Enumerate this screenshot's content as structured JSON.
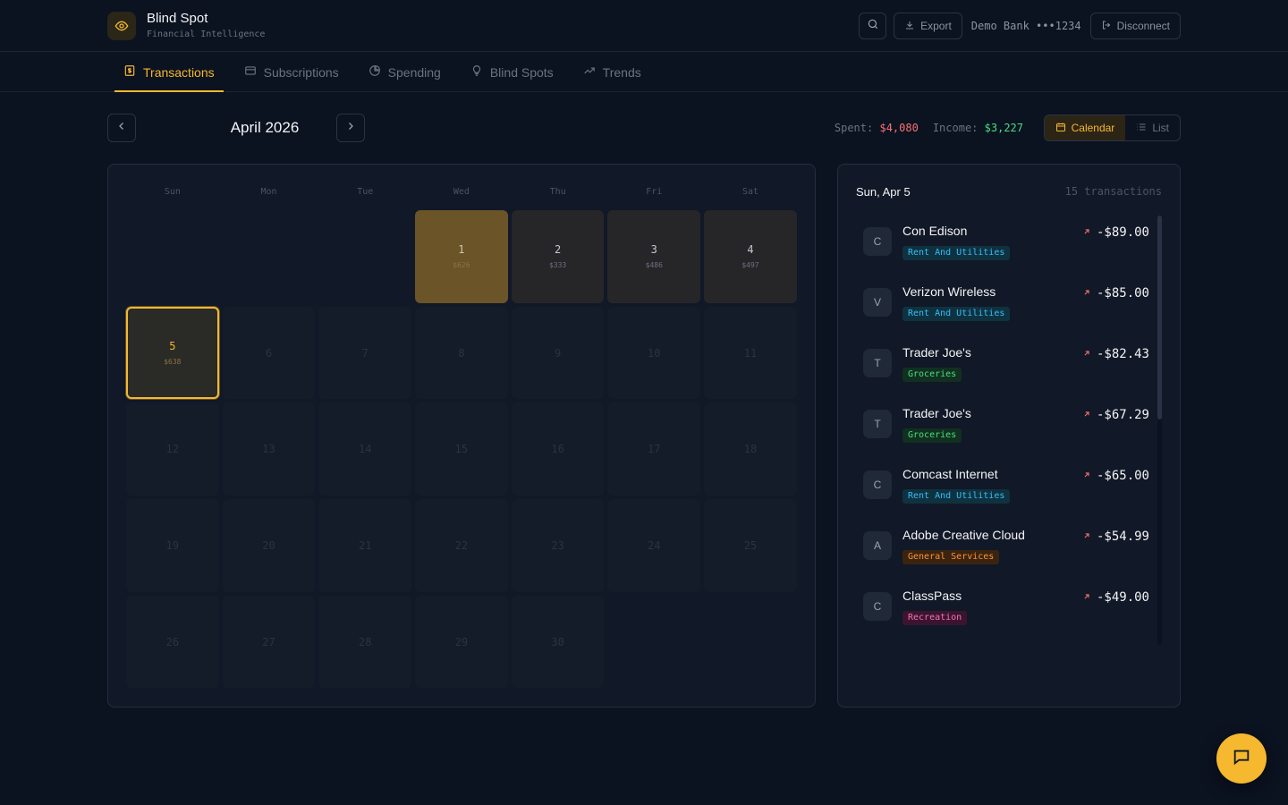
{
  "brand": {
    "title": "Blind Spot",
    "subtitle": "Financial Intelligence",
    "logo_icon": "eye-icon"
  },
  "header": {
    "search_icon": "search-icon",
    "export_label": "Export",
    "bank_label": "Demo Bank •••1234",
    "disconnect_label": "Disconnect"
  },
  "tabs": [
    {
      "label": "Transactions",
      "icon": "dollar-icon",
      "active": true
    },
    {
      "label": "Subscriptions",
      "icon": "card-icon",
      "active": false
    },
    {
      "label": "Spending",
      "icon": "pie-icon",
      "active": false
    },
    {
      "label": "Blind Spots",
      "icon": "bulb-icon",
      "active": false
    },
    {
      "label": "Trends",
      "icon": "trend-icon",
      "active": false
    }
  ],
  "toolbar": {
    "month": "April 2026",
    "spent_label": "Spent:",
    "spent_value": "$4,080",
    "income_label": "Income:",
    "income_value": "$3,227",
    "calendar_label": "Calendar",
    "list_label": "List"
  },
  "calendar": {
    "weekdays": [
      "Sun",
      "Mon",
      "Tue",
      "Wed",
      "Thu",
      "Fri",
      "Sat"
    ],
    "leading_empty": 3,
    "days": [
      {
        "day": "1",
        "amount": "$626",
        "state": "hot"
      },
      {
        "day": "2",
        "amount": "$333",
        "state": "active"
      },
      {
        "day": "3",
        "amount": "$486",
        "state": "active"
      },
      {
        "day": "4",
        "amount": "$497",
        "state": "active"
      },
      {
        "day": "5",
        "amount": "$638",
        "state": "selected"
      },
      {
        "day": "6",
        "amount": "",
        "state": "future"
      },
      {
        "day": "7",
        "amount": "",
        "state": "future"
      },
      {
        "day": "8",
        "amount": "",
        "state": "future"
      },
      {
        "day": "9",
        "amount": "",
        "state": "future"
      },
      {
        "day": "10",
        "amount": "",
        "state": "future"
      },
      {
        "day": "11",
        "amount": "",
        "state": "future"
      },
      {
        "day": "12",
        "amount": "",
        "state": "future"
      },
      {
        "day": "13",
        "amount": "",
        "state": "future"
      },
      {
        "day": "14",
        "amount": "",
        "state": "future"
      },
      {
        "day": "15",
        "amount": "",
        "state": "future"
      },
      {
        "day": "16",
        "amount": "",
        "state": "future"
      },
      {
        "day": "17",
        "amount": "",
        "state": "future"
      },
      {
        "day": "18",
        "amount": "",
        "state": "future"
      },
      {
        "day": "19",
        "amount": "",
        "state": "future"
      },
      {
        "day": "20",
        "amount": "",
        "state": "future"
      },
      {
        "day": "21",
        "amount": "",
        "state": "future"
      },
      {
        "day": "22",
        "amount": "",
        "state": "future"
      },
      {
        "day": "23",
        "amount": "",
        "state": "future"
      },
      {
        "day": "24",
        "amount": "",
        "state": "future"
      },
      {
        "day": "25",
        "amount": "",
        "state": "future"
      },
      {
        "day": "26",
        "amount": "",
        "state": "future"
      },
      {
        "day": "27",
        "amount": "",
        "state": "future"
      },
      {
        "day": "28",
        "amount": "",
        "state": "future"
      },
      {
        "day": "29",
        "amount": "",
        "state": "future"
      },
      {
        "day": "30",
        "amount": "",
        "state": "future"
      }
    ]
  },
  "detail": {
    "date": "Sun, Apr 5",
    "count": "15 transactions",
    "transactions": [
      {
        "initial": "C",
        "name": "Con Edison",
        "category": "Rent And Utilities",
        "cat_class": "cat-util",
        "amount": "-$89.00"
      },
      {
        "initial": "V",
        "name": "Verizon Wireless",
        "category": "Rent And Utilities",
        "cat_class": "cat-util",
        "amount": "-$85.00"
      },
      {
        "initial": "T",
        "name": "Trader Joe's",
        "category": "Groceries",
        "cat_class": "cat-groc",
        "amount": "-$82.43"
      },
      {
        "initial": "T",
        "name": "Trader Joe's",
        "category": "Groceries",
        "cat_class": "cat-groc",
        "amount": "-$67.29"
      },
      {
        "initial": "C",
        "name": "Comcast Internet",
        "category": "Rent And Utilities",
        "cat_class": "cat-util",
        "amount": "-$65.00"
      },
      {
        "initial": "A",
        "name": "Adobe Creative Cloud",
        "category": "General Services",
        "cat_class": "cat-gen",
        "amount": "-$54.99"
      },
      {
        "initial": "C",
        "name": "ClassPass",
        "category": "Recreation",
        "cat_class": "cat-rec",
        "amount": "-$49.00"
      }
    ]
  },
  "colors": {
    "accent": "#f5b82e",
    "background": "#0b1220",
    "panel": "#111827",
    "spent": "#f87171",
    "income": "#4ade80"
  }
}
